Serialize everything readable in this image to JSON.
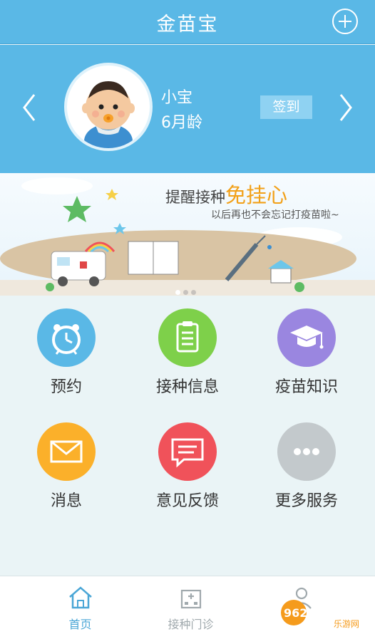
{
  "header": {
    "title": "金苗宝",
    "add_icon": "plus-circle-icon"
  },
  "profile": {
    "name": "小宝",
    "age": "6月龄",
    "signin_label": "签到",
    "prev_icon": "chevron-left-icon",
    "next_icon": "chevron-right-icon"
  },
  "banner": {
    "headline_prefix": "提醒接种",
    "headline_highlight": "免挂心",
    "subtitle": "以后再也不会忘记打疫苗啦~",
    "pages": 3,
    "active_page": 1
  },
  "menu": [
    {
      "label": "预约",
      "icon": "alarm-clock-icon",
      "color": "#5ab8e6"
    },
    {
      "label": "接种信息",
      "icon": "clipboard-icon",
      "color": "#7ed04a"
    },
    {
      "label": "疫苗知识",
      "icon": "graduation-cap-icon",
      "color": "#9a86e0"
    },
    {
      "label": "消息",
      "icon": "envelope-icon",
      "color": "#fbb02a"
    },
    {
      "label": "意见反馈",
      "icon": "chat-bubble-icon",
      "color": "#f0525a"
    },
    {
      "label": "更多服务",
      "icon": "more-dots-icon",
      "color": "#c3c9cc"
    }
  ],
  "tabbar": [
    {
      "label": "首页",
      "icon": "home-icon",
      "active": true
    },
    {
      "label": "接种门诊",
      "icon": "hospital-icon",
      "active": false
    },
    {
      "label": "",
      "icon": "user-icon",
      "active": false
    }
  ],
  "watermark": {
    "text": "962.NET",
    "subtext": "乐游网"
  },
  "colors": {
    "primary": "#5ab8e6",
    "accent": "#f2a018"
  }
}
